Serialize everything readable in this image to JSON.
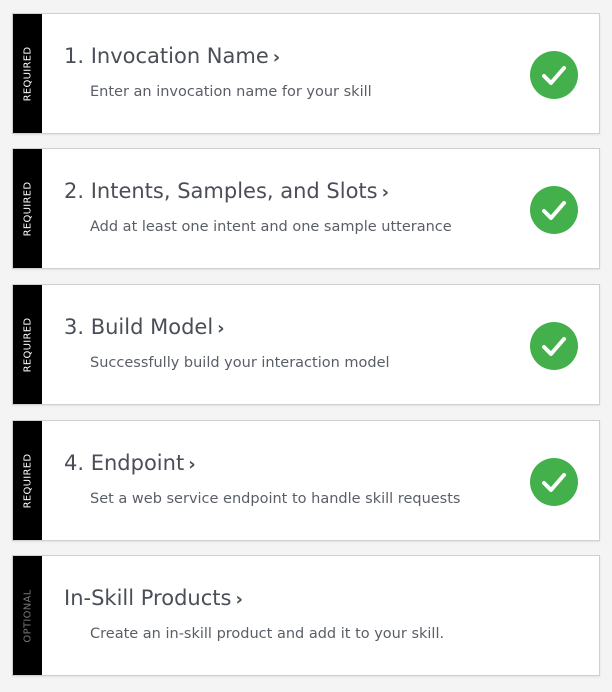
{
  "colors": {
    "check": "#44b04c",
    "strip": "#000000"
  },
  "steps": [
    {
      "tag": "REQUIRED",
      "title": "1. Invocation Name",
      "chevron": "›",
      "subtitle": "Enter an invocation name for your skill",
      "complete": true
    },
    {
      "tag": "REQUIRED",
      "title": "2. Intents, Samples, and Slots",
      "chevron": "›",
      "subtitle": "Add at least one intent and one sample utterance",
      "complete": true
    },
    {
      "tag": "REQUIRED",
      "title": "3. Build Model",
      "chevron": "›",
      "subtitle": "Successfully build your interaction model",
      "complete": true
    },
    {
      "tag": "REQUIRED",
      "title": "4. Endpoint",
      "chevron": "›",
      "subtitle": "Set a web service endpoint to handle skill requests",
      "complete": true
    },
    {
      "tag": "OPTIONAL",
      "title": "In-Skill Products",
      "chevron": "›",
      "subtitle": "Create an in-skill product and add it to your skill.",
      "complete": false
    }
  ]
}
